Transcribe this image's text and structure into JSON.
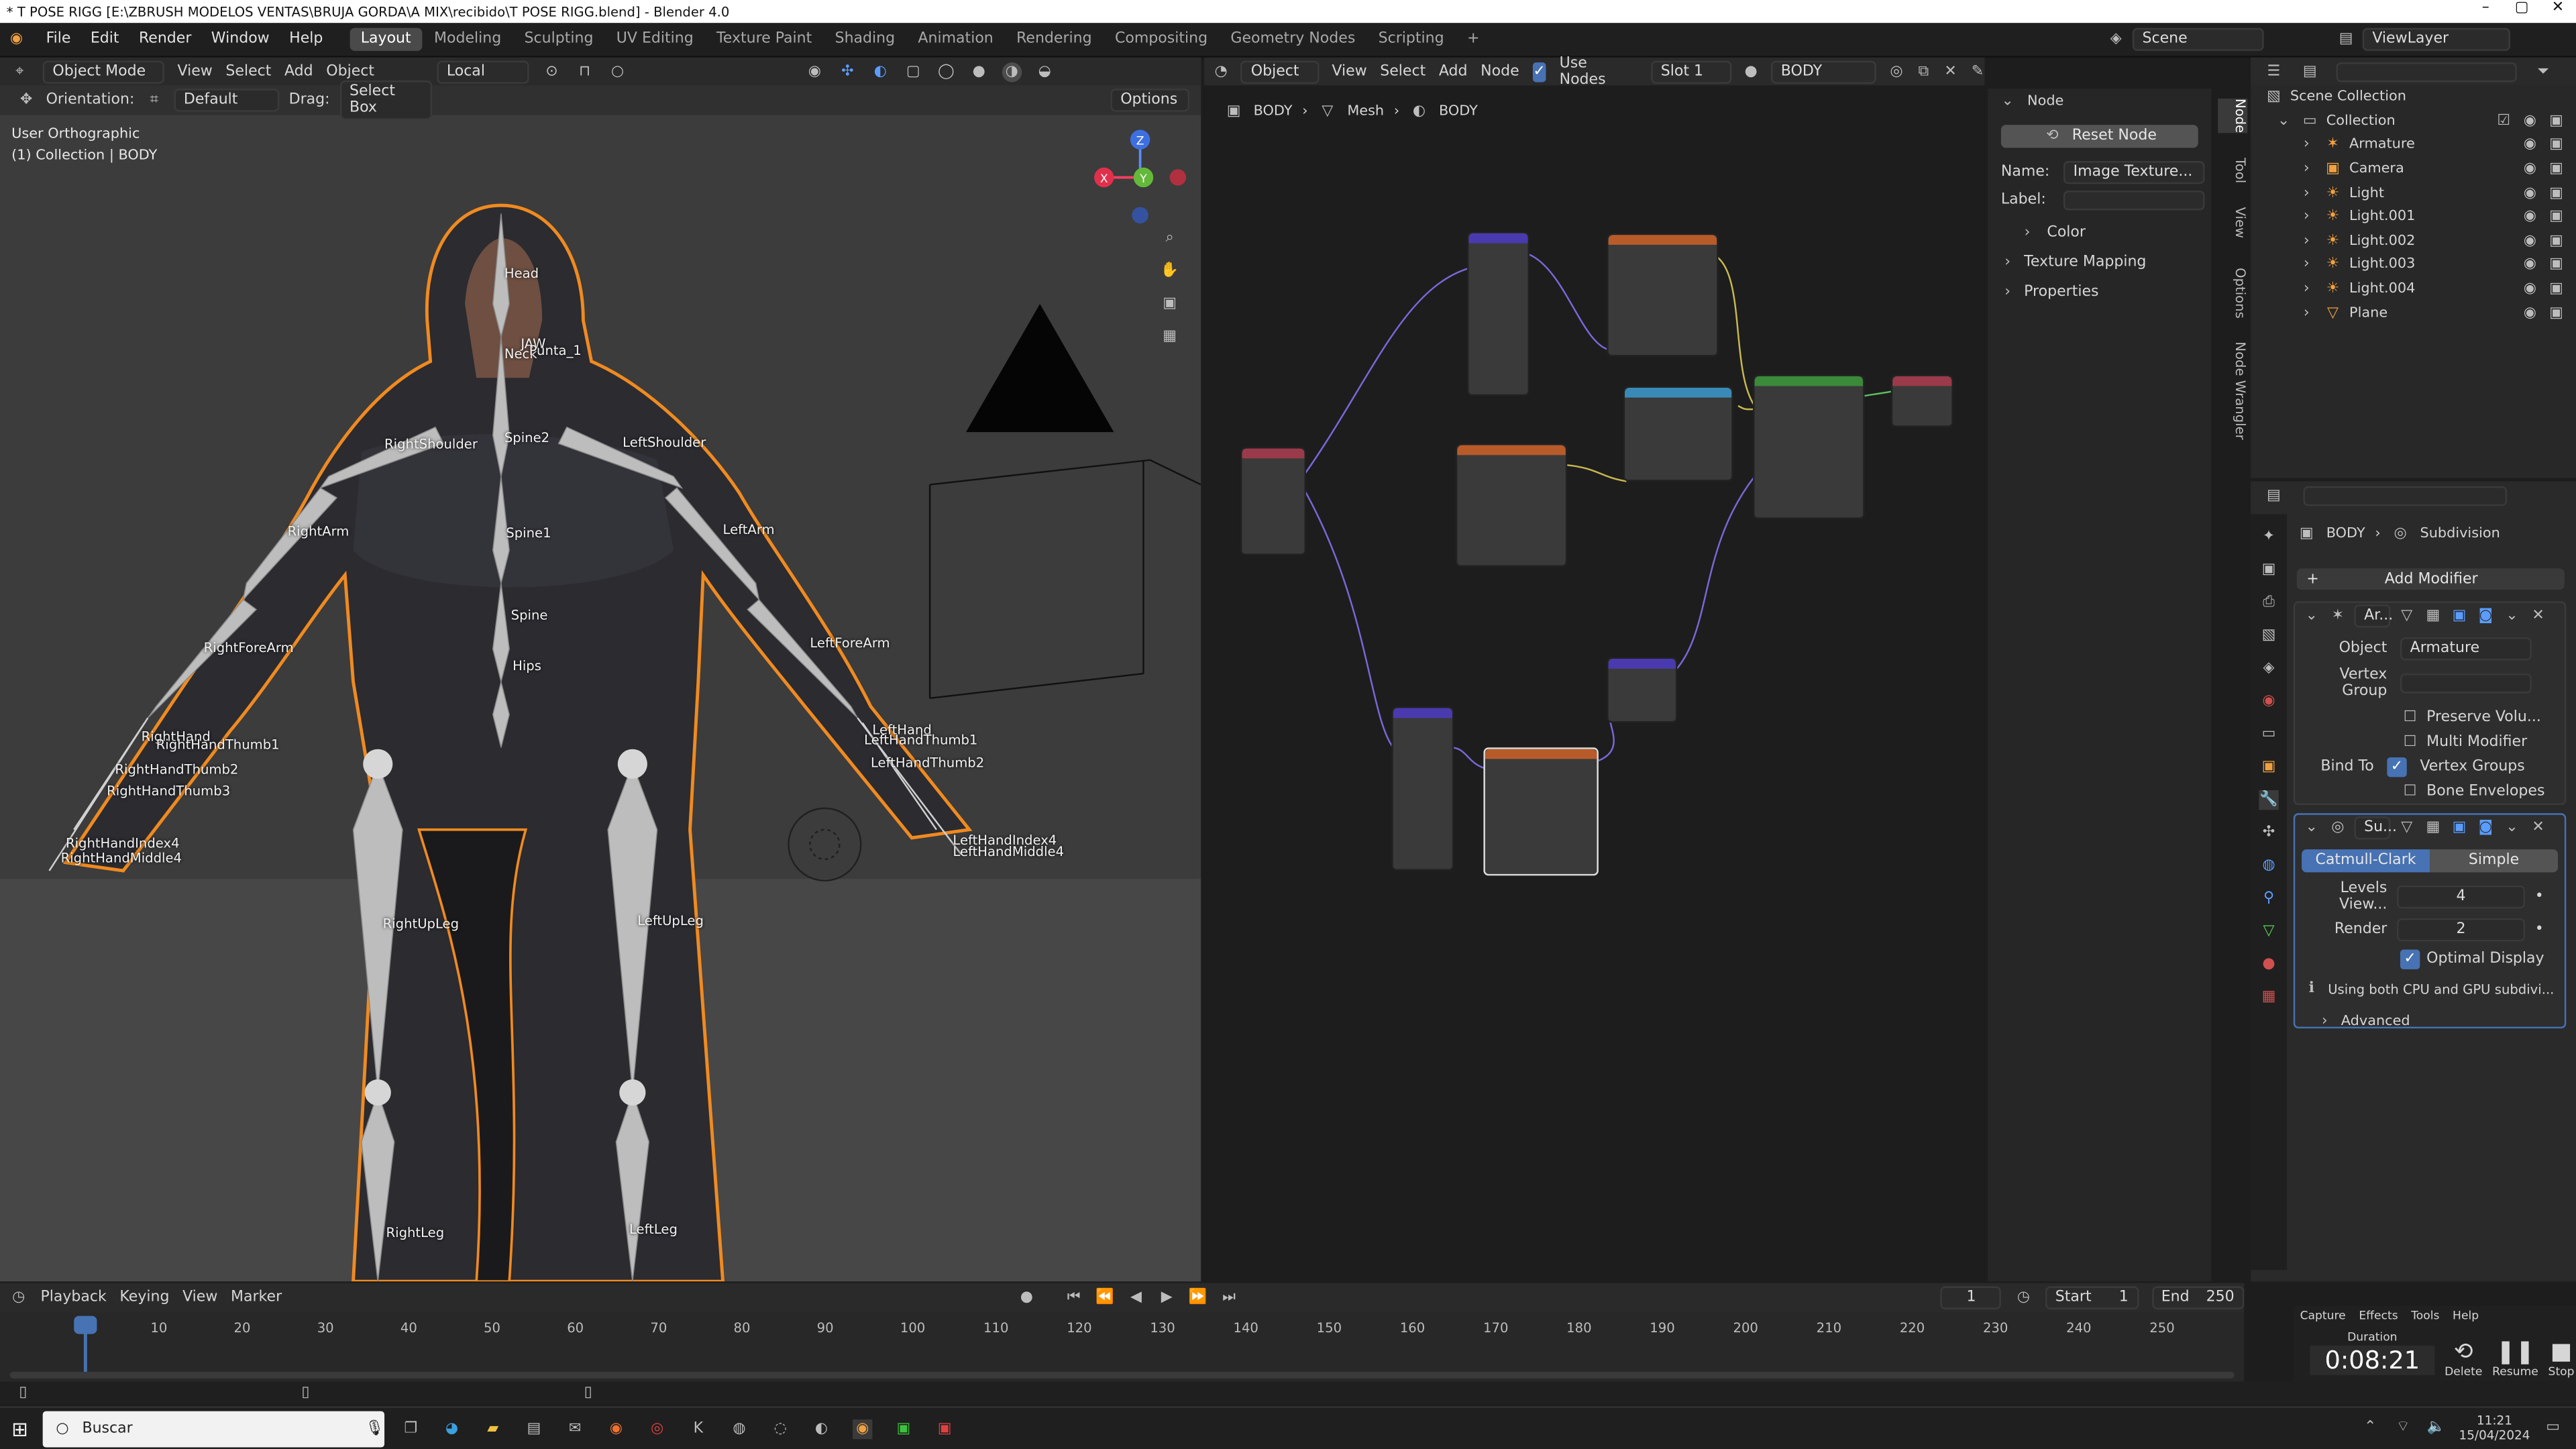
{
  "window": {
    "title": "* T POSE RIGG [E:\\ZBRUSH MODELOS VENTAS\\BRUJA GORDA\\A MIX\\recibido\\T POSE RIGG.blend] - Blender 4.0"
  },
  "menu": [
    "File",
    "Edit",
    "Render",
    "Window",
    "Help"
  ],
  "workspaces": [
    "Layout",
    "Modeling",
    "Sculpting",
    "UV Editing",
    "Texture Paint",
    "Shading",
    "Animation",
    "Rendering",
    "Compositing",
    "Geometry Nodes",
    "Scripting"
  ],
  "scene": {
    "label": "Scene",
    "view_layer": "ViewLayer"
  },
  "viewport": {
    "mode": "Object Mode",
    "menus": [
      "View",
      "Select",
      "Add",
      "Object"
    ],
    "transform": "Local",
    "shading_options": "Options",
    "orientation_label": "Orientation:",
    "orientation": "Default",
    "drag_label": "Drag:",
    "drag": "Select Box",
    "view_name": "User Orthographic",
    "collection_line": "(1) Collection | BODY",
    "bones": [
      "Head",
      "JAW",
      "Neck",
      "Punta_1",
      "RightShoulder",
      "Spine2",
      "LeftShoulder",
      "Spine1",
      "RightArm",
      "LeftArm",
      "Spine",
      "Hips",
      "RightForeArm",
      "LeftForeArm",
      "RightHand",
      "RightHandThumb1",
      "RightHandThumb2",
      "RightHandThumb3",
      "RightHandIndex4",
      "RightHandMiddle4",
      "LeftHand",
      "LeftHandThumb1",
      "LeftHandThumb2",
      "LeftHandIndex4",
      "LeftHandMiddle4",
      "RightUpLeg",
      "LeftUpLeg",
      "RightLeg",
      "LeftLeg"
    ],
    "gizmo": {
      "x": "X",
      "y": "Y",
      "z": "Z"
    }
  },
  "node_editor": {
    "type": "Object",
    "menus": [
      "View",
      "Select",
      "Add",
      "Node"
    ],
    "use_nodes": "Use Nodes",
    "slot": "Slot 1",
    "material": "BODY",
    "breadcrumb": [
      "BODY",
      "Mesh",
      "BODY"
    ]
  },
  "node_panel": {
    "header": "Node",
    "reset": "Reset Node",
    "name_label": "Name:",
    "name_value": "Image Texture...",
    "label_label": "Label:",
    "sections": [
      "Color",
      "Texture Mapping",
      "Properties"
    ]
  },
  "side_tabs": [
    "Node",
    "Tool",
    "View",
    "Options",
    "Node Wrangler"
  ],
  "outliner": {
    "title": "Scene Collection",
    "collection": "Collection",
    "items": [
      "Armature",
      "Camera",
      "Light",
      "Light.001",
      "Light.002",
      "Light.003",
      "Light.004",
      "Plane"
    ]
  },
  "properties": {
    "breadcrumb": [
      "BODY",
      "Subdivision"
    ],
    "add_modifier": "Add Modifier",
    "armature_mod": {
      "name": "Ar...",
      "object_label": "Object",
      "object_value": "Armature",
      "vgroup_label": "Vertex Group",
      "preserve": "Preserve Volu...",
      "multi": "Multi Modifier",
      "bind_label": "Bind To",
      "bind_vgroups": "Vertex Groups",
      "bind_env": "Bone Envelopes"
    },
    "subsurf_mod": {
      "name": "Su...",
      "catmull": "Catmull-Clark",
      "simple": "Simple",
      "levels_label": "Levels View...",
      "levels_value": "4",
      "render_label": "Render",
      "render_value": "2",
      "optimal": "Optimal Display",
      "info": "Using both CPU and GPU subdivi...",
      "advanced": "Advanced"
    }
  },
  "timeline": {
    "menus": [
      "Playback",
      "Keying",
      "View",
      "Marker"
    ],
    "current": "1",
    "start_label": "Start",
    "start": "1",
    "end_label": "End",
    "end": "250",
    "ticks": [
      "1",
      "10",
      "20",
      "30",
      "40",
      "50",
      "60",
      "70",
      "80",
      "90",
      "100",
      "110",
      "120",
      "130",
      "140",
      "150",
      "160",
      "170",
      "180",
      "190",
      "200",
      "210",
      "220",
      "230",
      "240",
      "250"
    ]
  },
  "capture": {
    "menus": [
      "Capture",
      "Effects",
      "Tools",
      "Help"
    ],
    "duration_label": "Duration",
    "duration": "0:08:21",
    "buttons": [
      "Delete",
      "Resume",
      "Stop"
    ]
  },
  "taskbar": {
    "search": "Buscar",
    "time": "11:21",
    "date": "15/04/2024"
  }
}
